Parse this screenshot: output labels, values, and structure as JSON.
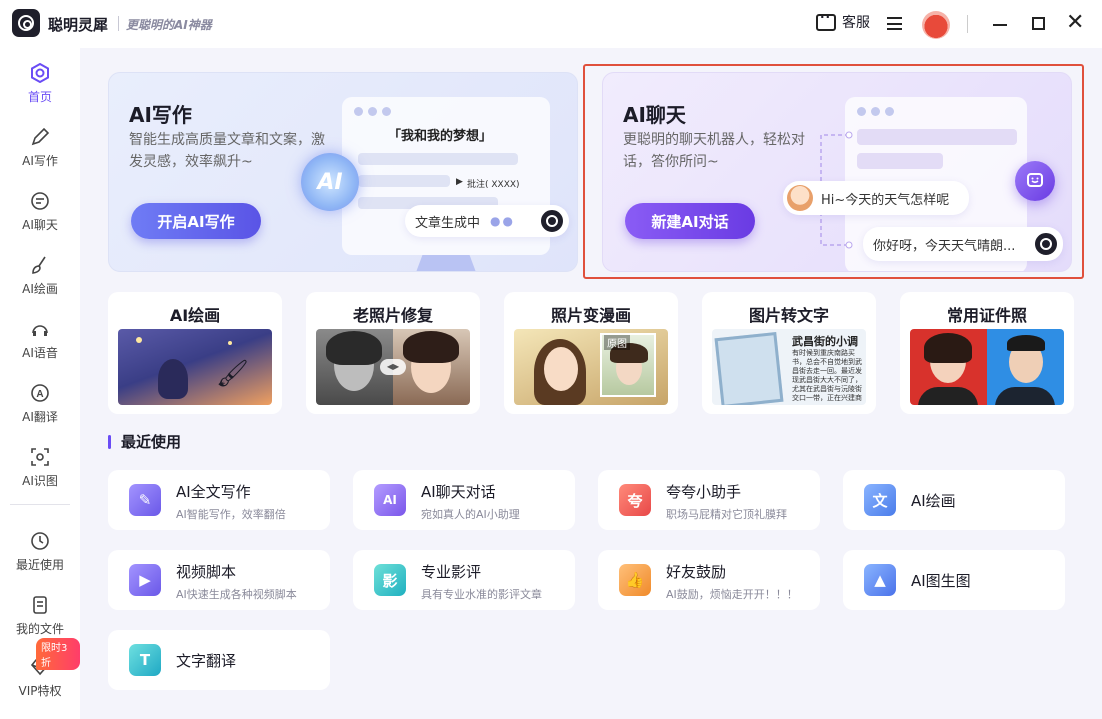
{
  "app": {
    "name": "聪明灵犀",
    "slogan": "更聪明的AI神器"
  },
  "header": {
    "service_label": "客服"
  },
  "sidebar": {
    "items": [
      {
        "label": "首页",
        "icon": "home-logo-icon"
      },
      {
        "label": "AI写作",
        "icon": "pen-icon"
      },
      {
        "label": "AI聊天",
        "icon": "chat-icon"
      },
      {
        "label": "AI绘画",
        "icon": "brush-icon"
      },
      {
        "label": "AI语音",
        "icon": "voice-icon"
      },
      {
        "label": "AI翻译",
        "icon": "translate-icon"
      },
      {
        "label": "AI识图",
        "icon": "scan-icon"
      },
      {
        "label": "最近使用",
        "icon": "clock-icon"
      },
      {
        "label": "我的文件",
        "icon": "file-icon"
      },
      {
        "label": "VIP特权",
        "icon": "diamond-icon"
      }
    ],
    "vip_badge": "限时3折"
  },
  "hero_write": {
    "title": "AI写作",
    "desc": "智能生成高质量文章和文案，激发灵感，效率飙升~",
    "button": "开启AI写作",
    "mock_heading": "「我和我的梦想」",
    "mock_tag": "批注( XXXX)",
    "mock_status": "文章生成中",
    "ai_badge": "AI"
  },
  "hero_chat": {
    "title": "AI聊天",
    "desc": "更聪明的聊天机器人，轻松对话，答你所问~",
    "button": "新建AI对话",
    "bubble_user": "Hi~今天的天气怎样呢",
    "bubble_bot": "你好呀，今天天气晴朗..."
  },
  "tools": [
    {
      "title": "AI绘画"
    },
    {
      "title": "老照片修复"
    },
    {
      "title": "照片变漫画",
      "tag": "原图"
    },
    {
      "title": "图片转文字",
      "book_title": "武昌街的小调",
      "book_text": "有时候到重庆南路买书，总会不自觉地到武昌街去走一回。最近发现武昌街大大不同了，尤其在武昌街与沅陵街交口一带，正在兴建商业大楼"
    },
    {
      "title": "常用证件照"
    }
  ],
  "recent": {
    "heading": "最近使用",
    "items": [
      {
        "title": "AI全文写作",
        "sub": "AI智能写作，效率翻倍",
        "icon_char": "✎",
        "color": "#7b6cf0"
      },
      {
        "title": "AI聊天对话",
        "sub": "宛如真人的AI小助理",
        "icon_char": "AI",
        "color": "#8a6cf2"
      },
      {
        "title": "夸夸小助手",
        "sub": "职场马屁精对它顶礼膜拜",
        "icon_char": "夸",
        "color": "#ef5a5a"
      },
      {
        "title": "AI绘画",
        "sub": "",
        "icon_char": "文",
        "color": "#5a8af0"
      },
      {
        "title": "视频脚本",
        "sub": "AI快速生成各种视频脚本",
        "icon_char": "▶",
        "color": "#7d6cf0"
      },
      {
        "title": "专业影评",
        "sub": "具有专业水准的影评文章",
        "icon_char": "影",
        "color": "#36c1c8"
      },
      {
        "title": "好友鼓励",
        "sub": "AI鼓励，烦恼走开开！！！",
        "icon_char": "👍",
        "color": "#f39a3a"
      },
      {
        "title": "AI图生图",
        "sub": "",
        "icon_char": "▲",
        "color": "#5a80ee"
      },
      {
        "title": "文字翻译",
        "sub": "",
        "icon_char": "T",
        "color": "#2fb8c8"
      }
    ]
  }
}
